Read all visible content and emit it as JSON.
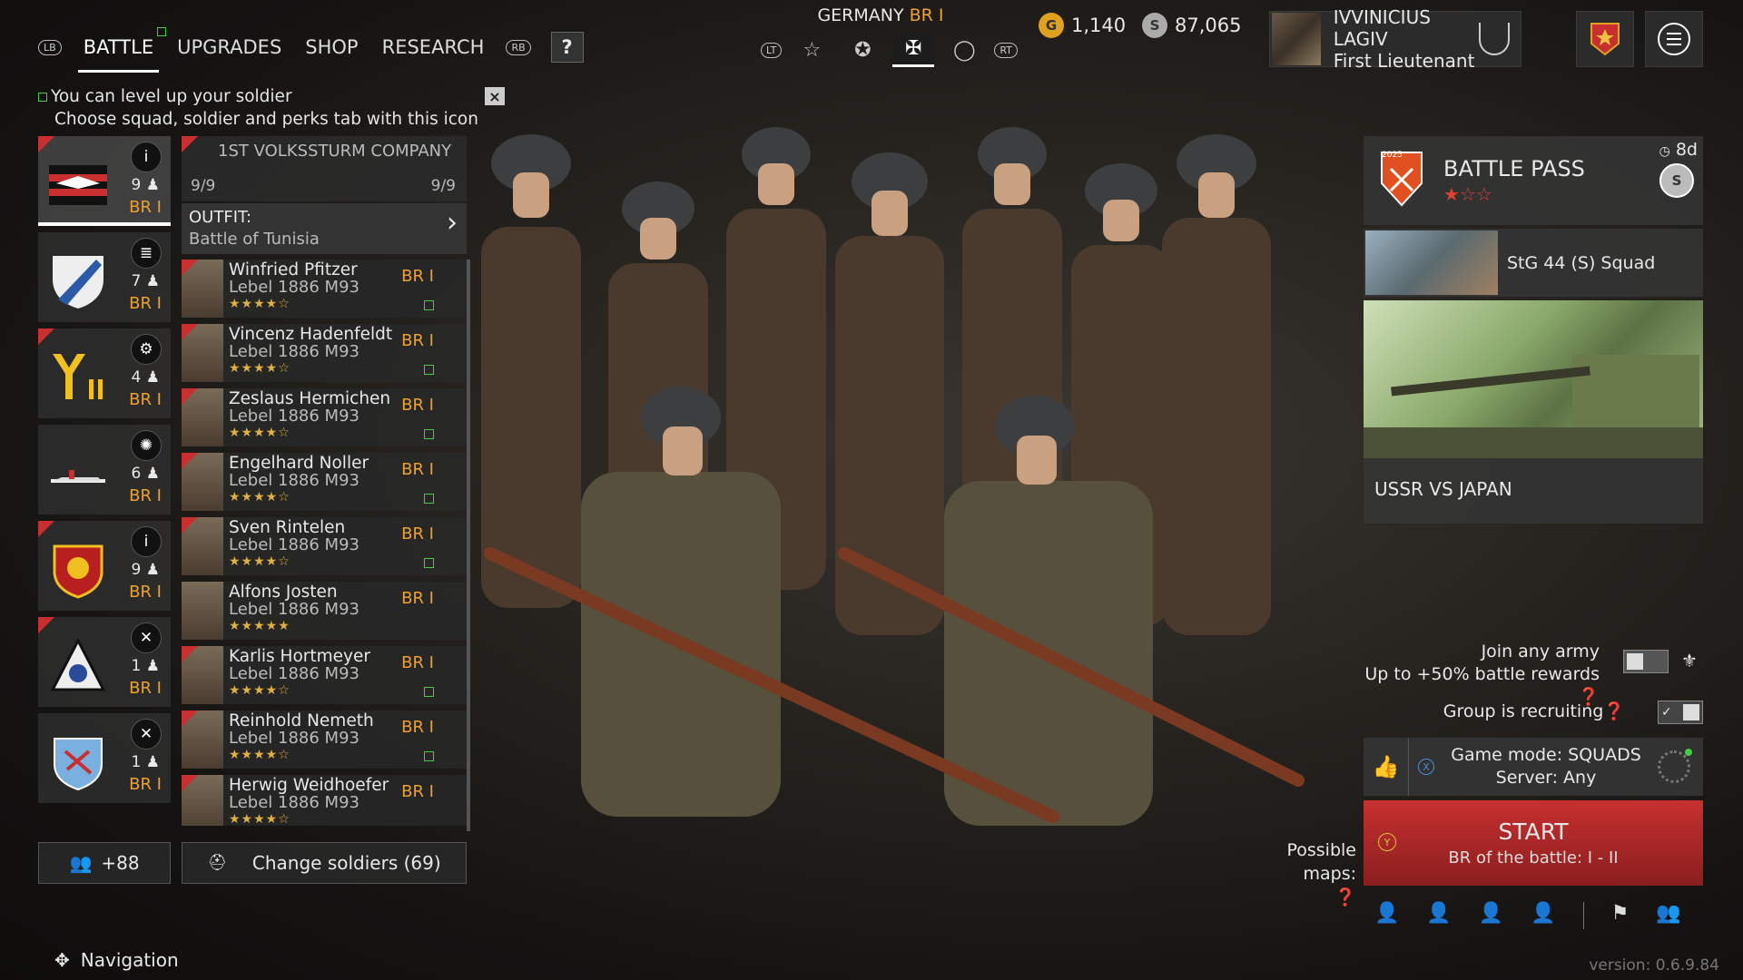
{
  "topnav": {
    "lb": "LB",
    "rb": "RB",
    "tabs": [
      "BATTLE",
      "UPGRADES",
      "SHOP",
      "RESEARCH"
    ],
    "help": "?"
  },
  "nation": {
    "name": "GERMANY",
    "br": "BR I"
  },
  "difficulty": {
    "lt": "LT",
    "rt": "RT"
  },
  "currency": {
    "gold": "1,140",
    "silver": "87,065"
  },
  "profile": {
    "name": "IVVINICIUS LAGIV",
    "rank": "First Lieutenant"
  },
  "hint": {
    "line1": "You can level up your soldier",
    "line2": "Choose squad, soldier and perks tab with this icon",
    "close": "×"
  },
  "squads": [
    {
      "count": "9",
      "br": "BR I",
      "class": "i",
      "emblem": "black-red-emblem-icon"
    },
    {
      "count": "7",
      "br": "BR I",
      "class": "≣",
      "emblem": "white-blue-shield-icon"
    },
    {
      "count": "4",
      "br": "BR I",
      "class": "⚙",
      "emblem": "yellow-y-emblem-icon"
    },
    {
      "count": "6",
      "br": "BR I",
      "class": "✺",
      "emblem": "plane-silhouette-icon"
    },
    {
      "count": "9",
      "br": "BR I",
      "class": "i",
      "emblem": "red-lion-shield-icon"
    },
    {
      "count": "1",
      "br": "BR I",
      "class": "✕",
      "emblem": "triangle-emblem-icon"
    },
    {
      "count": "1",
      "br": "BR I",
      "class": "✕",
      "emblem": "blue-eagle-shield-icon"
    }
  ],
  "company": {
    "name": "1ST VOLKSSTURM COMPANY",
    "left": "9/9",
    "right": "9/9"
  },
  "outfit": {
    "label": "OUTFIT:",
    "value": "Battle of Tunisia"
  },
  "soldiers": [
    {
      "name": "Winfried Pfitzer",
      "weapon": "Lebel 1886 M93",
      "br": "BR I",
      "stars": "★★★★☆"
    },
    {
      "name": "Vincenz Hadenfeldt",
      "weapon": "Lebel 1886 M93",
      "br": "BR I",
      "stars": "★★★★☆"
    },
    {
      "name": "Zeslaus Hermichen",
      "weapon": "Lebel 1886 M93",
      "br": "BR I",
      "stars": "★★★★☆"
    },
    {
      "name": "Engelhard Noller",
      "weapon": "Lebel 1886 M93",
      "br": "BR I",
      "stars": "★★★★☆"
    },
    {
      "name": "Sven Rintelen",
      "weapon": "Lebel 1886 M93",
      "br": "BR I",
      "stars": "★★★★☆"
    },
    {
      "name": "Alfons Josten",
      "weapon": "Lebel 1886 M93",
      "br": "BR I",
      "stars": "★★★★★"
    },
    {
      "name": "Karlis Hortmeyer",
      "weapon": "Lebel 1886 M93",
      "br": "BR I",
      "stars": "★★★★☆"
    },
    {
      "name": "Reinhold Nemeth",
      "weapon": "Lebel 1886 M93",
      "br": "BR I",
      "stars": "★★★★☆"
    },
    {
      "name": "Herwig Weidhoefer",
      "weapon": "Lebel 1886 M93",
      "br": "BR I",
      "stars": "★★★★☆"
    }
  ],
  "bottom_left": {
    "squad_count": "+88",
    "change": "Change soldiers (69)"
  },
  "battlepass": {
    "title": "BATTLE PASS",
    "timer": "8d",
    "stars": "★☆☆",
    "badge": "2025"
  },
  "event": {
    "squad": "StG 44 (S) Squad",
    "title": "USSR VS JAPAN"
  },
  "join": {
    "line1": "Join any army",
    "line2": "Up to +50% battle rewards",
    "group": "Group is recruiting"
  },
  "gamemode": {
    "mode": "Game mode: SQUADS",
    "server": "Server: Any"
  },
  "start": {
    "label": "START",
    "br": "BR of the battle: I - II"
  },
  "maps": {
    "line1": "Possible",
    "line2": "maps:"
  },
  "nav": {
    "label": "Navigation"
  },
  "version": "version: 0.6.9.84"
}
